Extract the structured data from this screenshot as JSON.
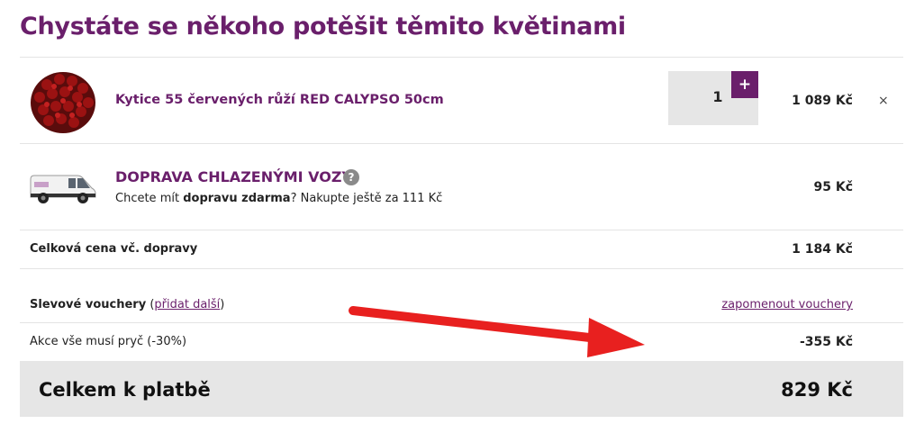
{
  "page": {
    "title": "Chystáte se někoho potěšit těmito květinami"
  },
  "product": {
    "name": "Kytice 55 červených růží RED CALYPSO 50cm",
    "quantity": "1",
    "plus_label": "+",
    "price": "1 089 Kč",
    "remove_label": "×",
    "image_icon": "red-roses-bouquet-icon"
  },
  "delivery": {
    "title": "DOPRAVA CHLAZENÝMI VOZY",
    "help_label": "?",
    "note_prefix": "Chcete mít ",
    "note_bold": "dopravu zdarma",
    "note_suffix": "? Nakupte ještě za 111 Kč",
    "price": "95 Kč",
    "image_icon": "delivery-van-icon"
  },
  "subtotal": {
    "label": "Celková cena vč. dopravy",
    "value": "1 184 Kč"
  },
  "vouchers": {
    "label": "Slevové vouchery",
    "open_paren": " (",
    "add_more_link": "přidat další",
    "close_paren": ")",
    "forget_link": "zapomenout vouchery"
  },
  "discount": {
    "label": "Akce vše musí pryč (-30%)",
    "value": "-355 Kč"
  },
  "total": {
    "label": "Celkem k platbě",
    "value": "829 Kč"
  },
  "colors": {
    "brand": "#6a1f6b",
    "arrow": "#e8201f",
    "panel": "#e6e6e6"
  }
}
